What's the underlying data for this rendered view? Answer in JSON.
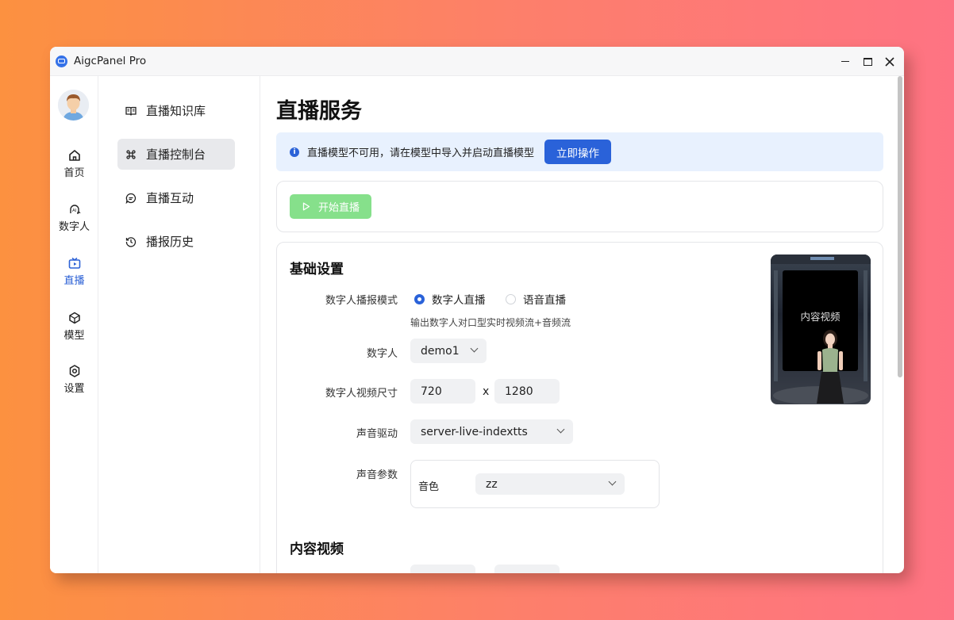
{
  "window": {
    "title": "AigcPanel Pro"
  },
  "rail": {
    "items": [
      {
        "label": "首页",
        "icon": "home-icon"
      },
      {
        "label": "数字人",
        "icon": "ai-head-icon"
      },
      {
        "label": "直播",
        "icon": "tv-icon",
        "active": true
      },
      {
        "label": "模型",
        "icon": "cube-icon"
      },
      {
        "label": "设置",
        "icon": "gear-icon"
      }
    ]
  },
  "subnav": {
    "items": [
      {
        "label": "直播知识库",
        "icon": "book-icon"
      },
      {
        "label": "直播控制台",
        "icon": "command-icon",
        "active": true
      },
      {
        "label": "直播互动",
        "icon": "chat-icon"
      },
      {
        "label": "播报历史",
        "icon": "history-icon"
      }
    ]
  },
  "main": {
    "title": "直播服务",
    "alert": {
      "text": "直播模型不可用，请在模型中导入并启动直播模型",
      "action": "立即操作"
    },
    "start_button": "开始直播",
    "basic": {
      "title": "基础设置",
      "mode_label": "数字人播报模式",
      "mode_options": [
        "数字人直播",
        "语音直播"
      ],
      "mode_selected": "数字人直播",
      "mode_hint": "输出数字人对口型实时视频流+音频流",
      "avatar_label": "数字人",
      "avatar_value": "demo1",
      "size_label": "数字人视频尺寸",
      "width": "720",
      "times": "x",
      "height": "1280",
      "voice_label": "声音驱动",
      "voice_value": "server-live-indextts",
      "param_label": "声音参数",
      "timbre_label": "音色",
      "timbre_value": "zz",
      "preview_text": "内容视频"
    },
    "content": {
      "title": "内容视频"
    }
  },
  "colors": {
    "accent": "#2a62d9",
    "start_button": "#86e08b",
    "alert_bg": "#e8f1fe"
  }
}
